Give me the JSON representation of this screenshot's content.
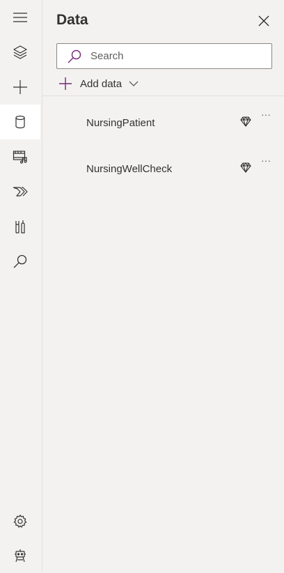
{
  "panel": {
    "title": "Data",
    "search": {
      "placeholder": "Search",
      "value": ""
    },
    "add_data_label": "Add data",
    "items": [
      {
        "label": "NursingPatient",
        "more": "···"
      },
      {
        "label": "NursingWellCheck",
        "more": "···"
      }
    ]
  },
  "rail": {
    "items": [
      "hamburger-menu",
      "tree-view",
      "insert",
      "data",
      "media",
      "power-automate",
      "advanced-tools",
      "search",
      "settings",
      "virtual-agent"
    ],
    "selected": "data"
  },
  "colors": {
    "accent": "#742774",
    "background": "#f3f2f1",
    "selected": "#ffffff"
  }
}
